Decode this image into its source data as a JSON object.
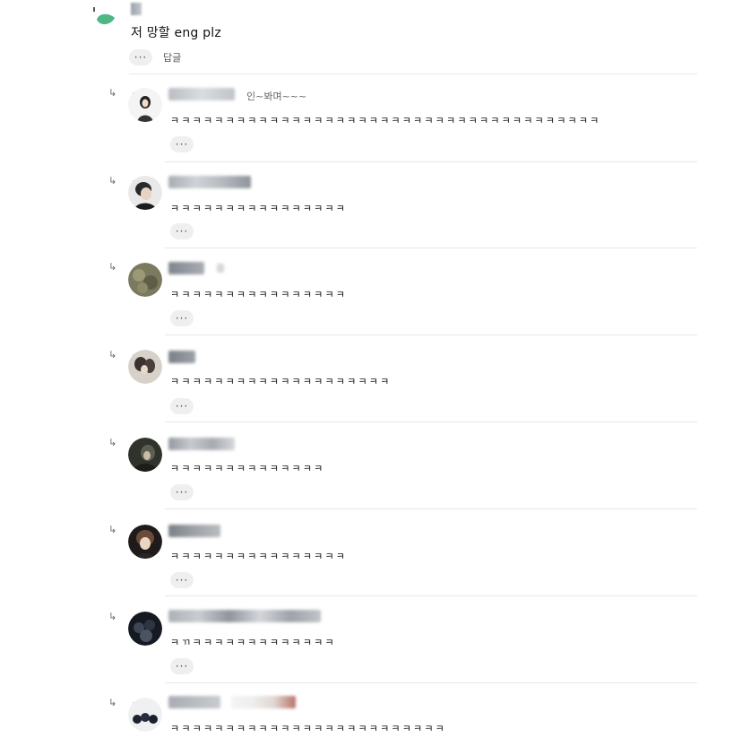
{
  "top_comment": {
    "text": "저 망할 eng plz",
    "more": "···",
    "reply_label": "답글"
  },
  "replies": [
    {
      "nick": "인~봐며~~~",
      "text": "ㅋㅋㅋㅋㅋㅋㅋㅋㅋㅋㅋㅋㅋㅋㅋㅋㅋㅋㅋㅋㅋㅋㅋㅋㅋㅋㅋㅋㅋㅋㅋㅋㅋㅋㅋㅋㅋㅋㅋ",
      "more": "···"
    },
    {
      "text": "ㅋㅋㅋㅋㅋㅋㅋㅋㅋㅋㅋㅋㅋㅋㅋㅋ",
      "more": "···"
    },
    {
      "text": "ㅋㅋㅋㅋㅋㅋㅋㅋㅋㅋㅋㅋㅋㅋㅋㅋ",
      "more": "···"
    },
    {
      "text": "ㅋㅋㅋㅋㅋㅋㅋㅋㅋㅋㅋㅋㅋㅋㅋㅋㅋㅋㅋㅋ",
      "more": "···"
    },
    {
      "text": "ㅋㅋㅋㅋㅋㅋㅋㅋㅋㅋㅋㅋㅋㅋ",
      "more": "···"
    },
    {
      "text": "ㅋㅋㅋㅋㅋㅋㅋㅋㅋㅋㅋㅋㅋㅋㅋㅋ",
      "more": "···"
    },
    {
      "text": "ㅋㄲㅋㅋㅋㅋㅋㅋㅋㅋㅋㅋㅋㅋㅋ",
      "more": "···"
    },
    {
      "text": "ㅋㅋㅋㅋㅋㅋㅋㅋㅋㅋㅋㅋㅋㅋㅋㅋㅋㅋㅋㅋㅋㅋㅋㅋㅋ",
      "more": "···"
    }
  ],
  "reply_icon": "reply-arrow-icon",
  "colors": {
    "leaf": "#4fb784",
    "divider": "#e7e7e7",
    "button_bg": "#efefef"
  }
}
